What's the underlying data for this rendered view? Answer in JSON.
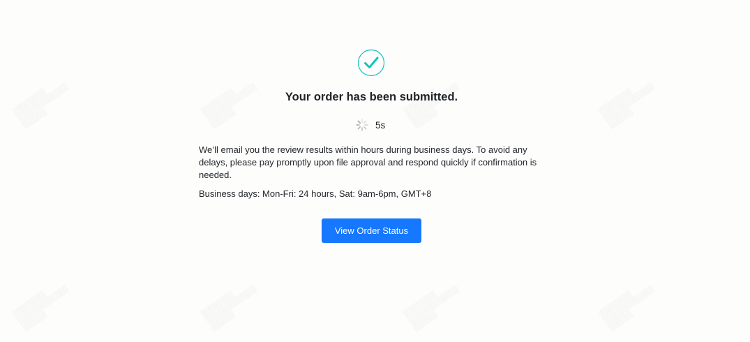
{
  "success": {
    "icon": "check-circle-icon",
    "title": "Your order has been submitted."
  },
  "countdown": {
    "icon": "loading-spinner-icon",
    "value": "5s"
  },
  "message": {
    "description": "We’ll email you the review results within hours during business days. To avoid any delays, please pay promptly upon file approval and respond quickly if confirmation is needed.",
    "business_days": "Business days: Mon-Fri: 24 hours, Sat: 9am-6pm, GMT+8"
  },
  "actions": {
    "view_status_label": "View Order Status"
  },
  "colors": {
    "accent": "#1677ff",
    "check": "#13c2c2"
  }
}
